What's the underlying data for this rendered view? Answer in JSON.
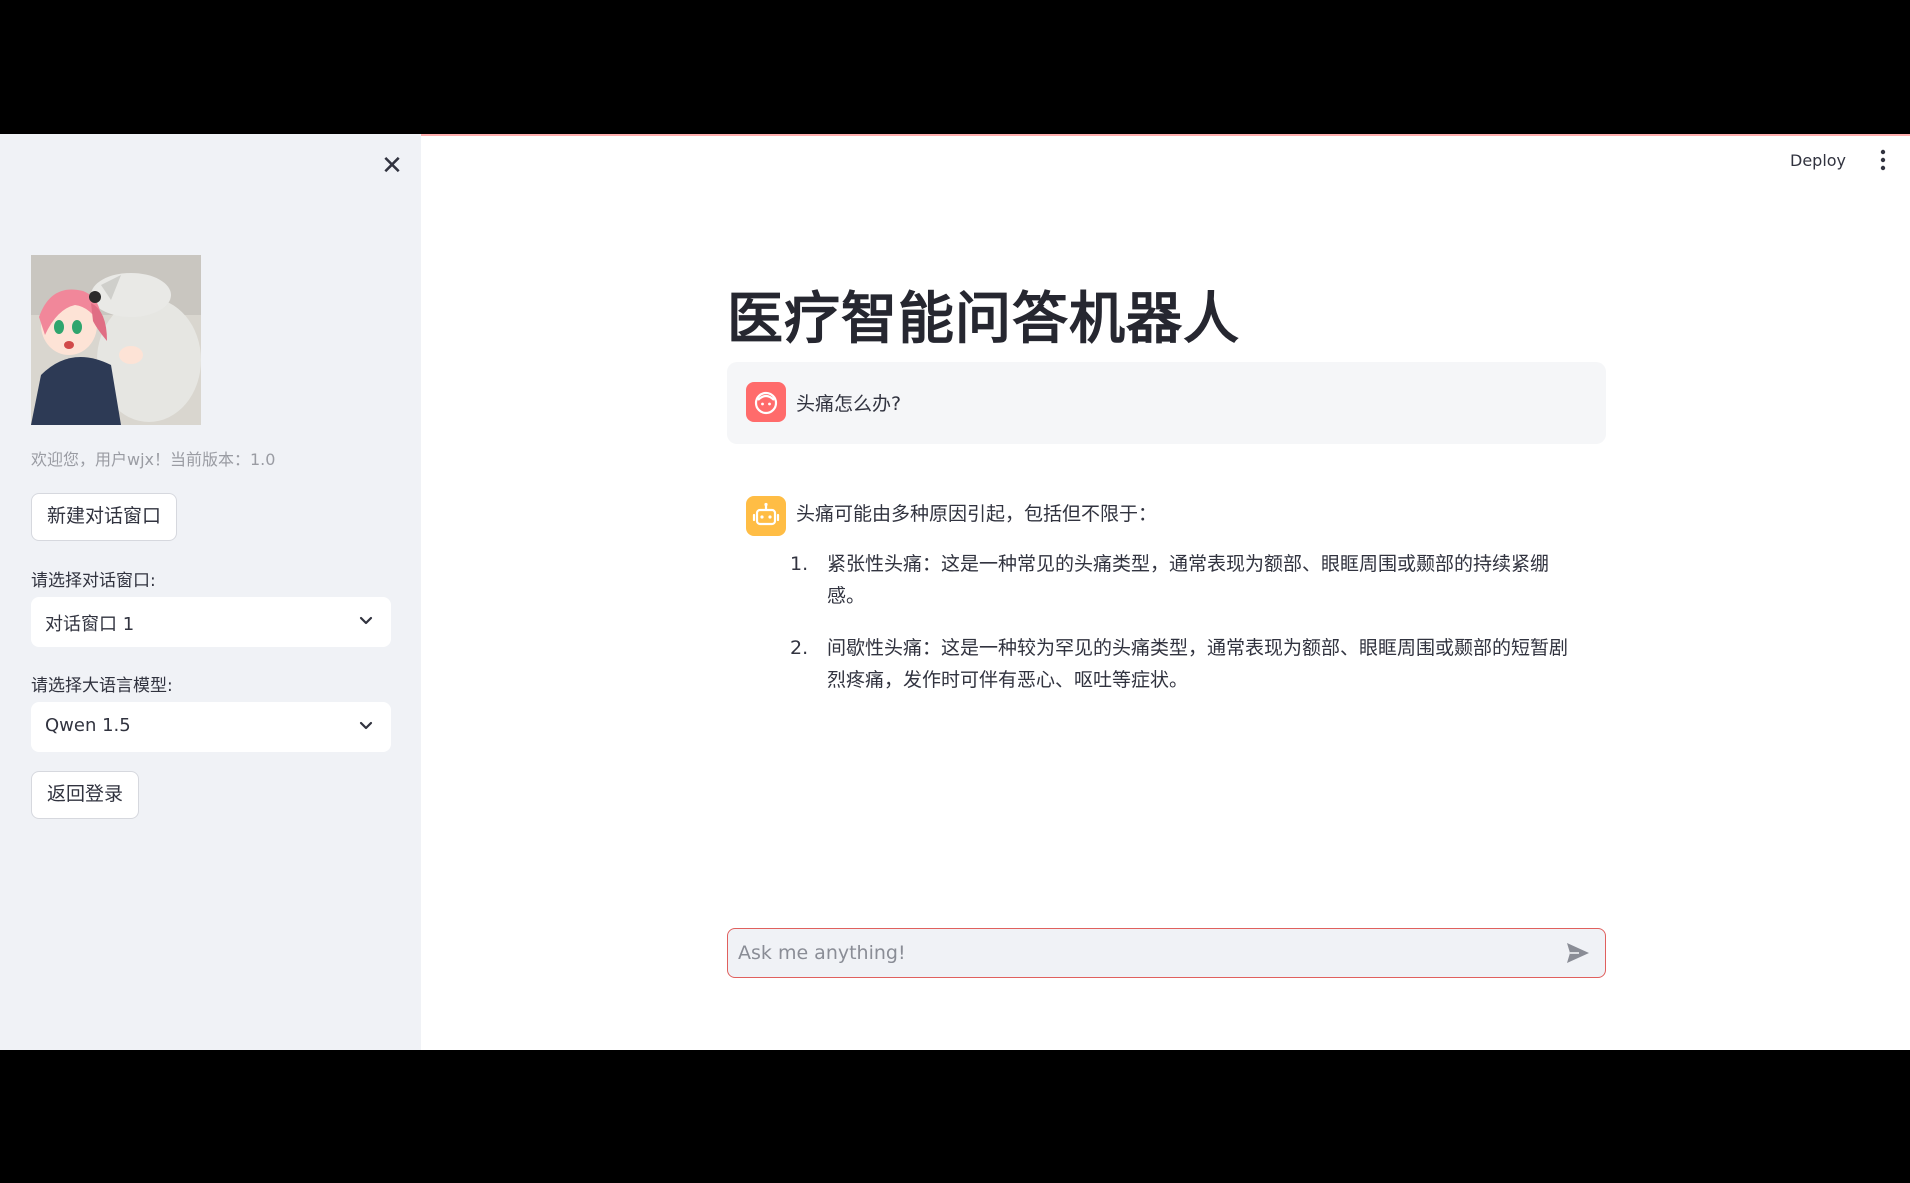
{
  "topbar": {
    "deploy_label": "Deploy"
  },
  "sidebar": {
    "close_icon": "close-icon",
    "avatar_alt": "anime-character-avatar",
    "welcome_text": "欢迎您，用户wjx！当前版本：1.0",
    "new_chat_label": "新建对话窗口",
    "chat_window_label": "请选择对话窗口:",
    "chat_window_value": "对话窗口 1",
    "model_label": "请选择大语言模型:",
    "model_value": "Qwen 1.5",
    "back_login_label": "返回登录"
  },
  "main": {
    "title": "医疗智能问答机器人",
    "user_message": "头痛怎么办?",
    "ai_intro": "头痛可能由多种原因引起，包括但不限于：",
    "ai_items": [
      {
        "num": "1.",
        "text": "紧张性头痛：这是一种常见的头痛类型，通常表现为额部、眼眶周围或颞部的持续紧绷感。"
      },
      {
        "num": "2.",
        "text": "间歇性头痛：这是一种较为罕见的头痛类型，通常表现为额部、眼眶周围或颞部的短暂剧烈疼痛，发作时可伴有恶心、呕吐等症状。"
      }
    ],
    "input_placeholder": "Ask me anything!"
  },
  "colors": {
    "user_avatar": "#ff6b6b",
    "ai_avatar": "#ffbd45",
    "input_border": "#e0605e",
    "sidebar_bg": "#f0f2f6"
  }
}
